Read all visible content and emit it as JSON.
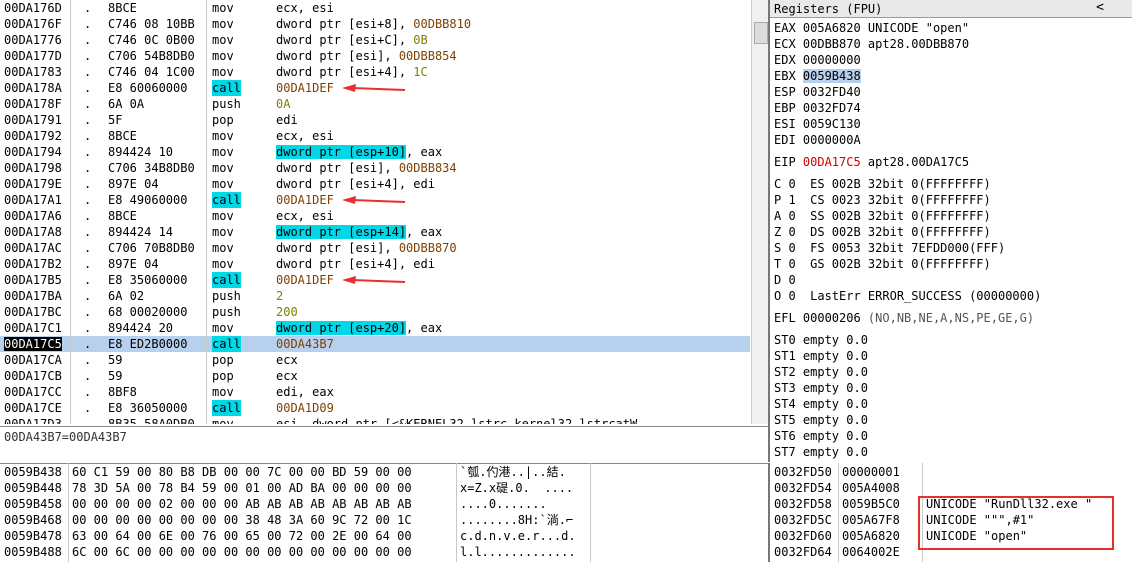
{
  "disasm": [
    {
      "addr": "00DA176D",
      "hex": "8BCE",
      "mn": "mov",
      "op": "ecx, esi"
    },
    {
      "addr": "00DA176F",
      "hex": "C746 08 10BB",
      "mn": "mov",
      "op": "dword ptr [esi+8], 00DBB810"
    },
    {
      "addr": "00DA1776",
      "hex": "C746 0C 0B00",
      "mn": "mov",
      "op": "dword ptr [esi+C], 0B"
    },
    {
      "addr": "00DA177D",
      "hex": "C706 54B8DB0",
      "mn": "mov",
      "op": "dword ptr [esi], 00DBB854"
    },
    {
      "addr": "00DA1783",
      "hex": "C746 04 1C00",
      "mn": "mov",
      "op": "dword ptr [esi+4], 1C"
    },
    {
      "addr": "00DA178A",
      "hex": "E8 60060000",
      "mn": "call",
      "op": "00DA1DEF",
      "mnhl": true,
      "arrow": true
    },
    {
      "addr": "00DA178F",
      "hex": "6A 0A",
      "mn": "push",
      "op": "0A"
    },
    {
      "addr": "00DA1791",
      "hex": "5F",
      "mn": "pop",
      "op": "edi"
    },
    {
      "addr": "00DA1792",
      "hex": "8BCE",
      "mn": "mov",
      "op": "ecx, esi"
    },
    {
      "addr": "00DA1794",
      "hex": "894424 10",
      "mn": "mov",
      "op": "dword ptr [esp+10], eax",
      "ophl": "dword ptr [esp+10]",
      "oprest": ", eax"
    },
    {
      "addr": "00DA1798",
      "hex": "C706 34B8DB0",
      "mn": "mov",
      "op": "dword ptr [esi], 00DBB834"
    },
    {
      "addr": "00DA179E",
      "hex": "897E 04",
      "mn": "mov",
      "op": "dword ptr [esi+4], edi"
    },
    {
      "addr": "00DA17A1",
      "hex": "E8 49060000",
      "mn": "call",
      "op": "00DA1DEF",
      "mnhl": true,
      "arrow": true
    },
    {
      "addr": "00DA17A6",
      "hex": "8BCE",
      "mn": "mov",
      "op": "ecx, esi"
    },
    {
      "addr": "00DA17A8",
      "hex": "894424 14",
      "mn": "mov",
      "op": "dword ptr [esp+14], eax",
      "ophl": "dword ptr [esp+14]",
      "oprest": ", eax"
    },
    {
      "addr": "00DA17AC",
      "hex": "C706 70B8DB0",
      "mn": "mov",
      "op": "dword ptr [esi], 00DBB870"
    },
    {
      "addr": "00DA17B2",
      "hex": "897E 04",
      "mn": "mov",
      "op": "dword ptr [esi+4], edi"
    },
    {
      "addr": "00DA17B5",
      "hex": "E8 35060000",
      "mn": "call",
      "op": "00DA1DEF",
      "mnhl": true,
      "arrow": true
    },
    {
      "addr": "00DA17BA",
      "hex": "6A 02",
      "mn": "push",
      "op": "2"
    },
    {
      "addr": "00DA17BC",
      "hex": "68 00020000",
      "mn": "push",
      "op": "200"
    },
    {
      "addr": "00DA17C1",
      "hex": "894424 20",
      "mn": "mov",
      "op": "dword ptr [esp+20], eax",
      "ophl": "dword ptr [esp+20]",
      "oprest": ", eax"
    },
    {
      "addr": "00DA17C5",
      "hex": "E8 ED2B0000",
      "mn": "call",
      "op": "00DA43B7",
      "mnhl": true,
      "sel": true
    },
    {
      "addr": "00DA17CA",
      "hex": "59",
      "mn": "pop",
      "op": "ecx"
    },
    {
      "addr": "00DA17CB",
      "hex": "59",
      "mn": "pop",
      "op": "ecx"
    },
    {
      "addr": "00DA17CC",
      "hex": "8BF8",
      "mn": "mov",
      "op": "edi, eax"
    },
    {
      "addr": "00DA17CE",
      "hex": "E8 36050000",
      "mn": "call",
      "op": "00DA1D09",
      "mnhl": true
    },
    {
      "addr": "00DA17D3",
      "hex": "8B35 58A0DB0",
      "mn": "mov",
      "op": "esi, dword ptr [<&KERNEL32.lstrc kernel32.lstrcatW"
    }
  ],
  "infoline": "00DA43B7=00DA43B7",
  "registers": {
    "title": "Registers (FPU)",
    "collapse_glyph": "<",
    "lines": [
      {
        "name": "EAX",
        "value": "005A6820",
        "comment": "UNICODE \"open\""
      },
      {
        "name": "ECX",
        "value": "00DBB870",
        "comment": "apt28.00DBB870"
      },
      {
        "name": "EDX",
        "value": "00000000",
        "comment": ""
      },
      {
        "name": "EBX",
        "value": "0059B438",
        "comment": "",
        "hl": true
      },
      {
        "name": "ESP",
        "value": "0032FD40",
        "comment": ""
      },
      {
        "name": "EBP",
        "value": "0032FD74",
        "comment": ""
      },
      {
        "name": "ESI",
        "value": "0059C130",
        "comment": ""
      },
      {
        "name": "EDI",
        "value": "0000000A",
        "comment": ""
      }
    ],
    "eip": {
      "name": "EIP",
      "value": "00DA17C5",
      "comment": "apt28.00DA17C5"
    },
    "flags": [
      "C 0  ES 002B 32bit 0(FFFFFFFF)",
      "P 1  CS 0023 32bit 0(FFFFFFFF)",
      "A 0  SS 002B 32bit 0(FFFFFFFF)",
      "Z 0  DS 002B 32bit 0(FFFFFFFF)",
      "S 0  FS 0053 32bit 7EFDD000(FFF)",
      "T 0  GS 002B 32bit 0(FFFFFFFF)",
      "D 0",
      "O 0  LastErr ERROR_SUCCESS (00000000)"
    ],
    "efl": {
      "name": "EFL",
      "value": "00000206",
      "comment": "(NO,NB,NE,A,NS,PE,GE,G)"
    },
    "fpu": [
      "ST0 empty 0.0",
      "ST1 empty 0.0",
      "ST2 empty 0.0",
      "ST3 empty 0.0",
      "ST4 empty 0.0",
      "ST5 empty 0.0",
      "ST6 empty 0.0",
      "ST7 empty 0.0"
    ]
  },
  "dump": [
    {
      "addr": "0059B438",
      "hex": "60 C1 59 00 80 B8 DB 00 00 7C 00 00 BD 59 00 00",
      "ascii": "`瓠.仢港..|..結."
    },
    {
      "addr": "0059B448",
      "hex": "78 3D 5A 00 78 B4 59 00 01 00 AD BA 00 00 00 00",
      "ascii": "x=Z.x碮.0.  ...."
    },
    {
      "addr": "0059B458",
      "hex": "00 00 00 00 02 00 00 00 AB AB AB AB AB AB AB AB",
      "ascii": "....0......."
    },
    {
      "addr": "0059B468",
      "hex": "00 00 00 00 00 00 00 00 38 48 3A 60 9C 72 00 1C",
      "ascii": "........8H:`淌.⌐"
    },
    {
      "addr": "0059B478",
      "hex": "63 00 64 00 6E 00 76 00 65 00 72 00 2E 00 64 00",
      "ascii": "c.d.n.v.e.r...d."
    },
    {
      "addr": "0059B488",
      "hex": "6C 00 6C 00 00 00 00 00 00 00 00 00 00 00 00 00",
      "ascii": "l.l............."
    }
  ],
  "stack": [
    {
      "addr": "0032FD50",
      "value": "00000001",
      "comment": ""
    },
    {
      "addr": "0032FD54",
      "value": "005A4008",
      "comment": ""
    },
    {
      "addr": "0032FD58",
      "value": "0059B5C0",
      "comment": "UNICODE \"RunDll32.exe \""
    },
    {
      "addr": "0032FD5C",
      "value": "005A67F8",
      "comment": "UNICODE \"\"\",#1\""
    },
    {
      "addr": "0032FD60",
      "value": "005A6820",
      "comment": "UNICODE \"open\""
    },
    {
      "addr": "0032FD64",
      "value": "0064002E",
      "comment": ""
    }
  ],
  "colors": {
    "highlight_cyan": "#00d8e8",
    "selection": "#b7d0ee",
    "arrow_red": "#e53030",
    "eip_red": "#d00000"
  }
}
